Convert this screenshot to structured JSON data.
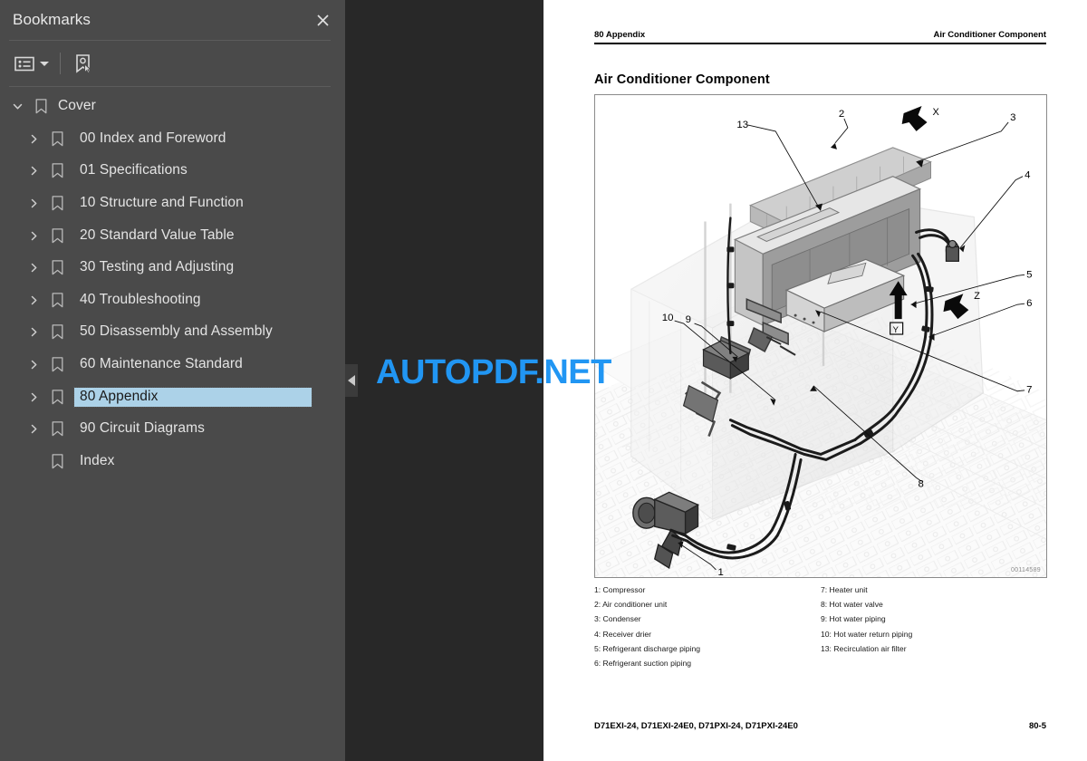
{
  "panel": {
    "title": "Bookmarks",
    "close_icon": "close-icon",
    "toolbar": {
      "options_icon": "list-options-icon",
      "new_bookmark_icon": "new-bookmark-icon"
    },
    "items": [
      {
        "label": "Cover",
        "level": 0,
        "expanded": true,
        "has_children": true,
        "selected": false
      },
      {
        "label": "00 Index and Foreword",
        "level": 1,
        "expanded": false,
        "has_children": true,
        "selected": false
      },
      {
        "label": "01 Specifications",
        "level": 1,
        "expanded": false,
        "has_children": true,
        "selected": false
      },
      {
        "label": "10 Structure and Function",
        "level": 1,
        "expanded": false,
        "has_children": true,
        "selected": false
      },
      {
        "label": "20 Standard Value Table",
        "level": 1,
        "expanded": false,
        "has_children": true,
        "selected": false
      },
      {
        "label": "30 Testing and Adjusting",
        "level": 1,
        "expanded": false,
        "has_children": true,
        "selected": false
      },
      {
        "label": "40 Troubleshooting",
        "level": 1,
        "expanded": false,
        "has_children": true,
        "selected": false
      },
      {
        "label": "50 Disassembly and Assembly",
        "level": 1,
        "expanded": false,
        "has_children": true,
        "selected": false
      },
      {
        "label": "60 Maintenance Standard",
        "level": 1,
        "expanded": false,
        "has_children": true,
        "selected": false
      },
      {
        "label": "80 Appendix",
        "level": 1,
        "expanded": false,
        "has_children": true,
        "selected": true
      },
      {
        "label": "90 Circuit Diagrams",
        "level": 1,
        "expanded": false,
        "has_children": true,
        "selected": false
      },
      {
        "label": "Index",
        "level": 1,
        "expanded": false,
        "has_children": false,
        "selected": false
      }
    ]
  },
  "collapse_handle": {
    "icon": "triangle-left-icon"
  },
  "watermark": {
    "text": "AUTOPDF.NET",
    "color": "#2196f3"
  },
  "page": {
    "header_left": "80 Appendix",
    "header_right": "Air Conditioner Component",
    "title": "Air Conditioner Component",
    "figure_id": "00114589",
    "figure_callouts": [
      "13",
      "2",
      "X",
      "3",
      "4",
      "Y",
      "Z",
      "5",
      "6",
      "10",
      "9",
      "7",
      "8",
      "1"
    ],
    "legend_left": [
      "1: Compressor",
      "2: Air conditioner unit",
      "3: Condenser",
      "4: Receiver drier",
      "5: Refrigerant discharge piping",
      "6: Refrigerant suction piping"
    ],
    "legend_right": [
      "7: Heater unit",
      "8: Hot water valve",
      "9: Hot water piping",
      "10: Hot water return piping",
      "13: Recirculation air filter"
    ],
    "footer_left": "D71EXI-24, D71EXI-24E0, D71PXI-24, D71PXI-24E0",
    "footer_right": "80-5"
  }
}
